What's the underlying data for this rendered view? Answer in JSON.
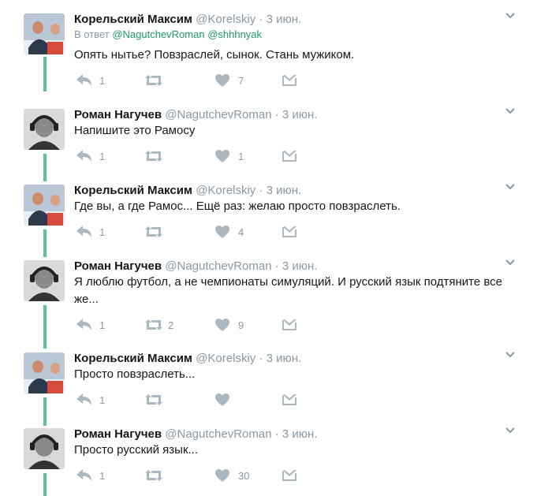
{
  "colors": {
    "thread_line": "#5cc1a0",
    "muted": "#8899a6",
    "mention": "#1e9a6a",
    "icon": "#aab8c2"
  },
  "icons": [
    "reply-icon",
    "retweet-icon",
    "like-icon",
    "direct-message-icon",
    "chevron-down-icon"
  ],
  "tweets": [
    {
      "name": "Корельский Максим",
      "handle": "@Korelskiy",
      "dot": "·",
      "date": "3 июн.",
      "reply_prefix": "В ответ",
      "mentions": "@NagutchevRoman @shhhnyak",
      "text": "Опять нытье? Повзраслей, сынок. Стань мужиком.",
      "replies": "1",
      "retweets": "",
      "likes": "7"
    },
    {
      "name": "Роман Нагучев",
      "handle": "@NagutchevRoman",
      "dot": "·",
      "date": "3 июн.",
      "text": "Напишите это Рамосу",
      "replies": "1",
      "retweets": "",
      "likes": "1"
    },
    {
      "name": "Корельский Максим",
      "handle": "@Korelskiy",
      "dot": "·",
      "date": "3 июн.",
      "text": "Где вы, а где Рамос... Ещё раз: желаю просто повзраслеть.",
      "replies": "1",
      "retweets": "",
      "likes": "4"
    },
    {
      "name": "Роман Нагучев",
      "handle": "@NagutchevRoman",
      "dot": "·",
      "date": "3 июн.",
      "text": "Я люблю футбол, а не чемпионаты симуляций. И русский язык подтяните все же...",
      "replies": "1",
      "retweets": "2",
      "likes": "9"
    },
    {
      "name": "Корельский Максим",
      "handle": "@Korelskiy",
      "dot": "·",
      "date": "3 июн.",
      "text": "Просто повзраслеть...",
      "replies": "1",
      "retweets": "",
      "likes": ""
    },
    {
      "name": "Роман Нагучев",
      "handle": "@NagutchevRoman",
      "dot": "·",
      "date": "3 июн.",
      "text": "Просто русский язык...",
      "replies": "1",
      "retweets": "",
      "likes": "30"
    }
  ]
}
